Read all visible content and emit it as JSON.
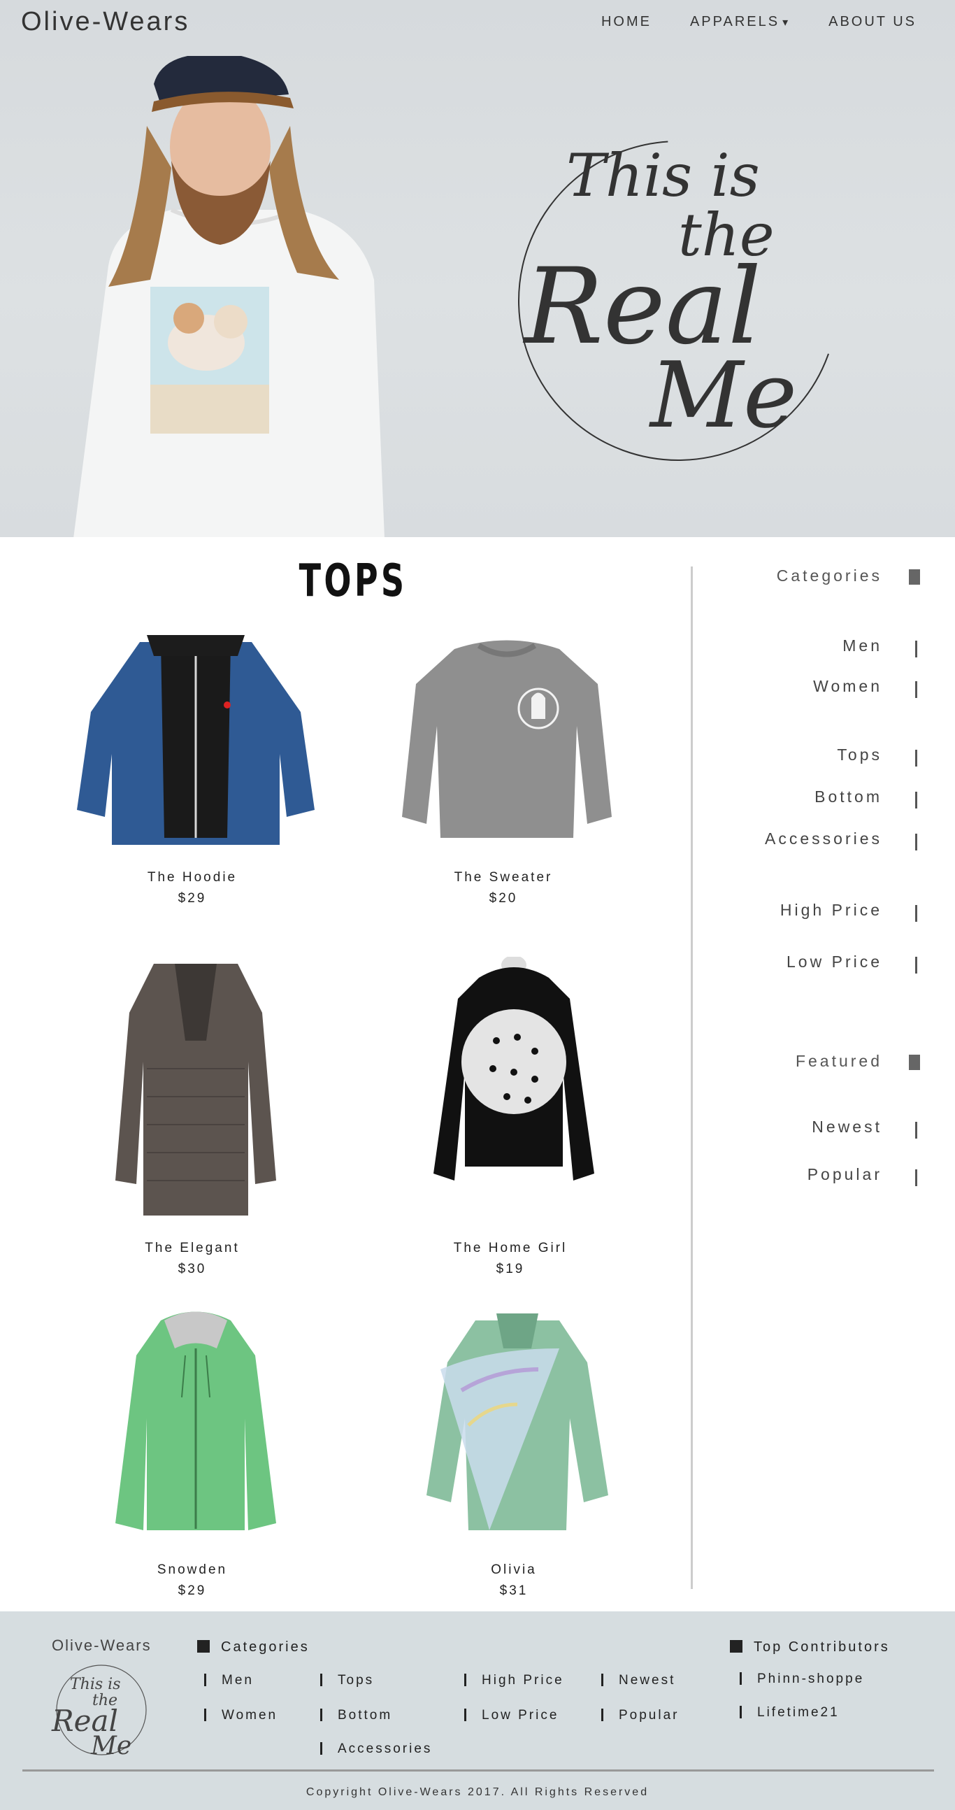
{
  "header": {
    "logo": "Olive-Wears",
    "nav": [
      {
        "label": "HOME"
      },
      {
        "label": "APPARELS",
        "caret": "▾"
      },
      {
        "label": "ABOUT US"
      }
    ]
  },
  "hero": {
    "slogan_lines": [
      "This is",
      "the",
      "Real",
      "Me"
    ]
  },
  "main": {
    "title": "TOPS",
    "products": [
      {
        "name": "The Hoodie",
        "price": "$29",
        "icon": "jacket-image",
        "color": "#2f5a94"
      },
      {
        "name": "The Sweater",
        "price": "$20",
        "icon": "sweater-image",
        "color": "#8f8f8f"
      },
      {
        "name": "The Elegant",
        "price": "$30",
        "icon": "cardigan-image",
        "color": "#5c544f"
      },
      {
        "name": "The Home Girl",
        "price": "$19",
        "icon": "hoodie-image",
        "color": "#111111"
      },
      {
        "name": "Snowden",
        "price": "$29",
        "icon": "zip-hoodie-image",
        "color": "#6dc581"
      },
      {
        "name": "Olivia",
        "price": "$31",
        "icon": "shirt-scarf-image",
        "color": "#8cc1a2"
      }
    ]
  },
  "sidebar": {
    "categories_label": "Categories",
    "items": [
      "Men",
      "Women",
      "Tops",
      "Bottom",
      "Accessories",
      "High Price",
      "Low Price"
    ],
    "featured_label": "Featured",
    "featured": [
      "Newest",
      "Popular"
    ]
  },
  "footer": {
    "logo": "Olive-Wears",
    "seal_lines": [
      "This is",
      "the",
      "Real",
      "Me"
    ],
    "categories_label": "Categories",
    "col1": [
      "Men",
      "Women"
    ],
    "col2": [
      "Tops",
      "Bottom",
      "Accessories"
    ],
    "col3": [
      "High Price",
      "Low Price"
    ],
    "col4": [
      "Newest",
      "Popular"
    ],
    "contributors_label": "Top Contributors",
    "contributors": [
      "Phinn-shoppe",
      "Lifetime21"
    ],
    "copyright": "Copyright Olive-Wears 2017. All Rights Reserved"
  }
}
